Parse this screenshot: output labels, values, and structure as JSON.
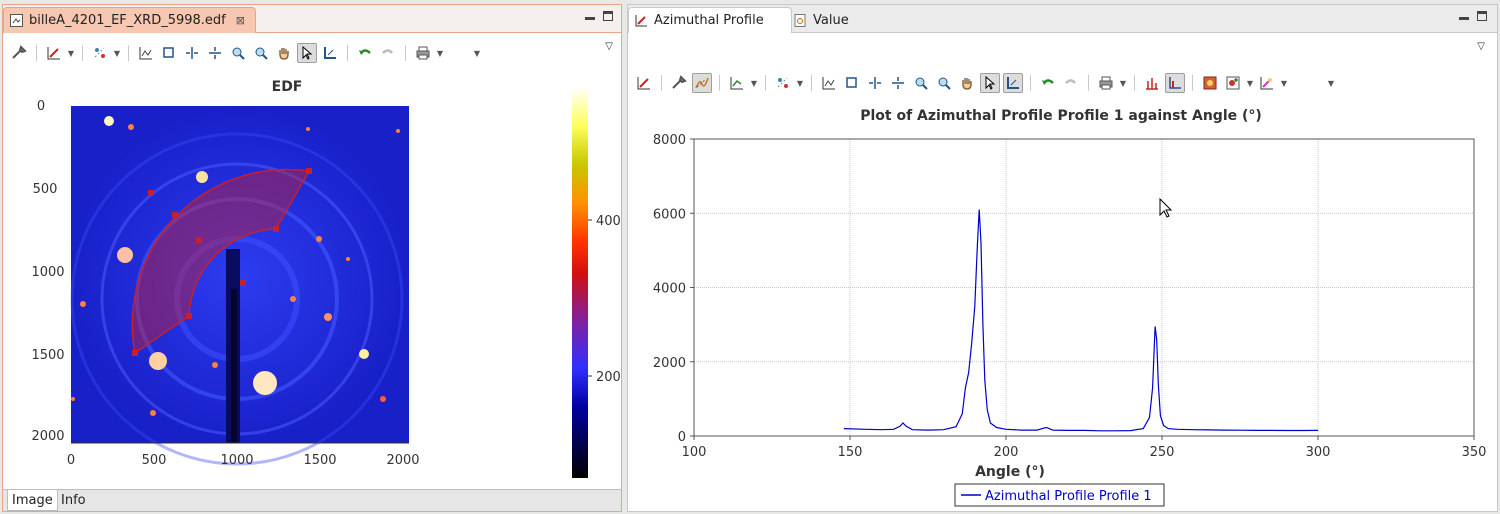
{
  "left_pane": {
    "tab_title": "billeA_4201_EF_XRD_5998.edf",
    "tab_close": "⊠",
    "image_title": "EDF",
    "y_ticks": [
      "0",
      "500",
      "1000",
      "1500",
      "2000"
    ],
    "x_ticks": [
      "0",
      "500",
      "1000",
      "1500",
      "2000"
    ],
    "colorbar_ticks": [
      "400",
      "200"
    ],
    "bottom_tabs": [
      "Image",
      "Info"
    ]
  },
  "right_pane": {
    "tabs": [
      "Azimuthal Profile",
      "Value"
    ],
    "view_menu_glyph": "▽"
  },
  "colors": {
    "accent_border": "#e8a489",
    "active_tab": "#f7c7b1",
    "plot_line": "#0000cc",
    "image_background": "#1a22d8",
    "sector_roi": "#c8202a"
  },
  "chart_data": {
    "type": "line",
    "title": "Plot of Azimuthal Profile Profile 1 against Angle (°)",
    "xlabel": "Angle (°)",
    "ylabel": "",
    "xlim": [
      100,
      350
    ],
    "ylim": [
      0,
      8000
    ],
    "x_ticks": [
      100,
      150,
      200,
      250,
      300,
      350
    ],
    "y_ticks": [
      0,
      2000,
      4000,
      6000,
      8000
    ],
    "grid": true,
    "legend": "bottom-center",
    "series": [
      {
        "name": "Azimuthal Profile Profile 1",
        "x": [
          148,
          155,
          160,
          164,
          166,
          167,
          168,
          170,
          175,
          180,
          184,
          186,
          187,
          188,
          189,
          190,
          190.8,
          191.4,
          192,
          192.6,
          193.2,
          194,
          195,
          197,
          200,
          205,
          210,
          212,
          213,
          215,
          220,
          225,
          230,
          235,
          240,
          244,
          246,
          247,
          247.8,
          248.3,
          248.8,
          249.5,
          250.5,
          252,
          255,
          260,
          265,
          270,
          275,
          280,
          285,
          290,
          295,
          300
        ],
        "y": [
          200,
          180,
          170,
          180,
          260,
          350,
          260,
          170,
          160,
          170,
          250,
          600,
          1300,
          1700,
          2500,
          3500,
          5100,
          6100,
          5200,
          3000,
          1500,
          700,
          350,
          230,
          180,
          160,
          160,
          210,
          230,
          160,
          150,
          150,
          140,
          140,
          145,
          200,
          500,
          1300,
          2950,
          2600,
          1400,
          550,
          280,
          200,
          180,
          170,
          165,
          160,
          155,
          150,
          150,
          148,
          148,
          150
        ]
      }
    ]
  }
}
